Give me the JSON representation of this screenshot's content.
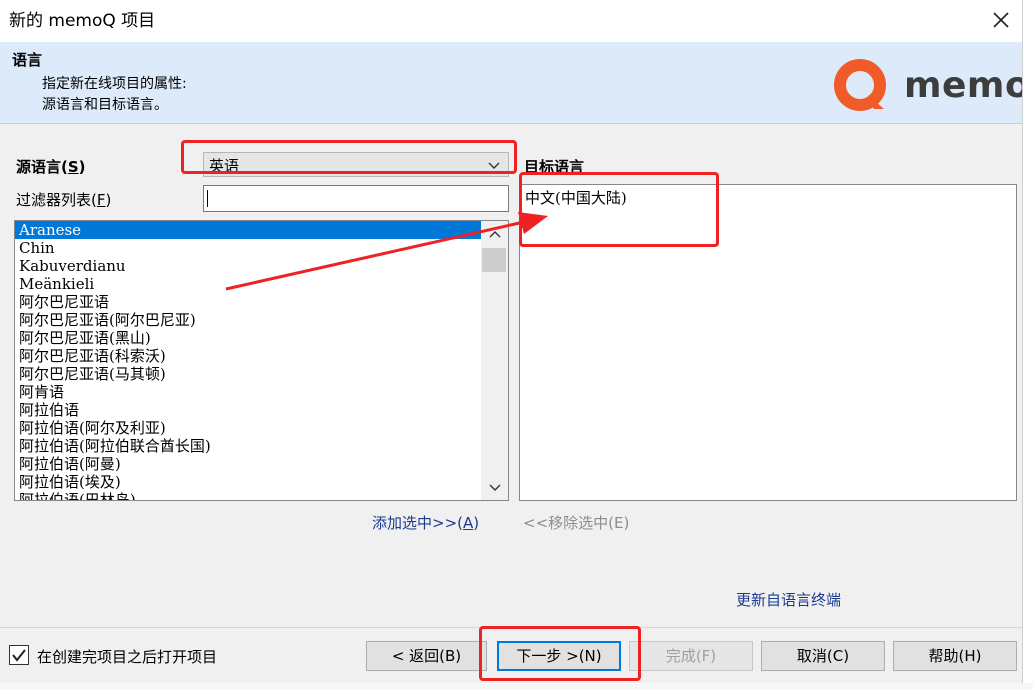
{
  "window": {
    "title": "新的 memoQ 项目"
  },
  "header": {
    "title": "语言",
    "desc_line1": "指定新在线项目的属性:",
    "desc_line2": "源语言和目标语言。",
    "logo_text": "memoq",
    "logo_color": "#f15a29"
  },
  "source": {
    "label_prefix": "源语言(",
    "label_key": "S",
    "label_suffix": ")",
    "selected": "英语",
    "filter_label_prefix": "过滤器列表(",
    "filter_label_key": "F",
    "filter_label_suffix": ")",
    "filter_value": "",
    "items": [
      "Aranese",
      "Chin",
      "Kabuverdianu",
      "Meänkieli",
      "阿尔巴尼亚语",
      "阿尔巴尼亚语(阿尔巴尼亚)",
      "阿尔巴尼亚语(黑山)",
      "阿尔巴尼亚语(科索沃)",
      "阿尔巴尼亚语(马其顿)",
      "阿肯语",
      "阿拉伯语",
      "阿拉伯语(阿尔及利亚)",
      "阿拉伯语(阿拉伯联合酋长国)",
      "阿拉伯语(阿曼)",
      "阿拉伯语(埃及)",
      "阿拉伯语(巴林岛)"
    ]
  },
  "target": {
    "label": "目标语言",
    "items": [
      "中文(中国大陆)"
    ]
  },
  "actions": {
    "add": "添加选中>>(",
    "add_key": "A",
    "add_suffix": ")",
    "remove": "<<移除选中(E)",
    "update_link": "更新自语言终端"
  },
  "footer": {
    "open_after_create": "在创建完项目之后打开项目",
    "open_checked": true,
    "back": "< 返回(B)",
    "next": "下一步 >(N)",
    "finish": "完成(F)",
    "cancel": "取消(C)",
    "help": "帮助(H)"
  },
  "colors": {
    "annotation": "#ee2222",
    "selection": "#0078d7",
    "header_bg": "#ddeaf9"
  }
}
